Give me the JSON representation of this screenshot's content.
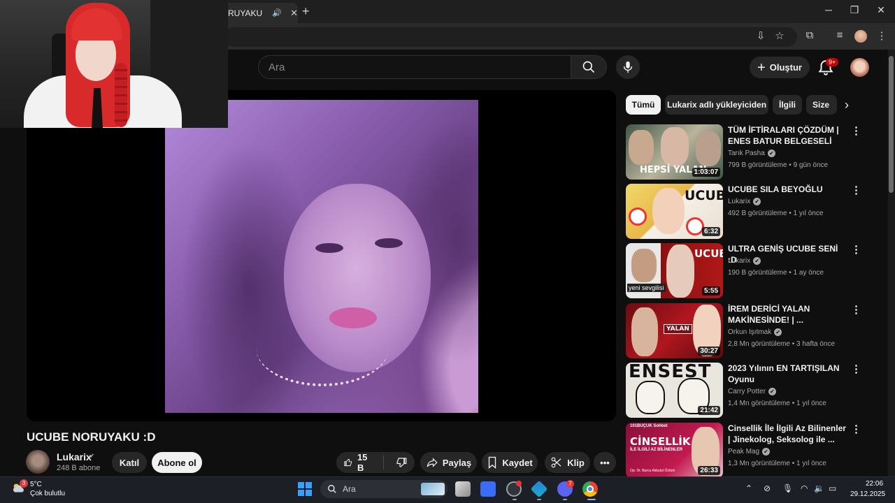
{
  "browser": {
    "tab_title": "RUYAKU :D",
    "tab_audio_icon": "speaker-icon",
    "new_tab_icon": "plus-icon",
    "window_controls": {
      "minimize": "─",
      "restore": "❐",
      "close": "✕"
    }
  },
  "youtube": {
    "search_placeholder": "Ara",
    "create_label": "Oluştur",
    "notification_count": "9+"
  },
  "video": {
    "title": "UCUBE NORUYAKU :D",
    "channel": "Lukarix",
    "subscribers": "248 B abone",
    "join_label": "Katıl",
    "subscribe_label": "Abone ol",
    "likes": "15 B",
    "share_label": "Paylaş",
    "save_label": "Kaydet",
    "clip_label": "Klip"
  },
  "chips": [
    "Tümü",
    "Lukarix adlı yükleyiciden",
    "İlgili",
    "Size"
  ],
  "recommendations": [
    {
      "title": "TÜM İFTİRALARI ÇÖZDÜM | ENES BATUR BELGESELİ",
      "channel": "Tarık Pasha",
      "views": "799 B görüntüleme",
      "age": "9 gün önce",
      "duration": "1:03:07",
      "thumb_text": "HEPSİ YALAN"
    },
    {
      "title": "UCUBE SILA BEYOĞLU",
      "channel": "Lukarix",
      "views": "492 B görüntüleme",
      "age": "1 yıl önce",
      "duration": "6:32",
      "thumb_text": "UCUBE"
    },
    {
      "title": "ULTRA GENİŞ UCUBE SENİ :D",
      "channel": "Lukarix",
      "views": "190 B görüntüleme",
      "age": "1 ay önce",
      "duration": "5:55",
      "thumb_text": "UCUBE",
      "thumb_caption": "yeni sevgilisi"
    },
    {
      "title": "İREM DERİCİ YALAN MAKİNESİNDE! | ...",
      "channel": "Orkun Işıtmak",
      "views": "2,8 Mn görüntüleme",
      "age": "3 hafta önce",
      "duration": "30:27",
      "thumb_text": "YALAN"
    },
    {
      "title": "2023 Yılının EN TARTIŞILAN Oyunu",
      "channel": "Carry Potter",
      "views": "1,4 Mn görüntüleme",
      "age": "1 yıl önce",
      "duration": "21:42",
      "thumb_text": "ENSEST"
    },
    {
      "title": "Cinsellik İle İlgili Az Bilinenler | Jinekolog, Seksolog ile ...",
      "channel": "Peak Mag",
      "views": "1,3 Mn görüntüleme",
      "age": "1 yıl önce",
      "duration": "26:33",
      "thumb_text": "CİNSELLİK",
      "thumb_caption": "İLE İLGİLİ AZ BİLİNENLER",
      "thumb_top": "101BUÇUK Sohbet",
      "thumb_name": "Op. Dr. Burcu Akbulut Öztürk"
    }
  ],
  "taskbar": {
    "weather_badge": "3",
    "temperature": "5°C",
    "condition": "Çok bulutlu",
    "search_label": "Ara",
    "discord_badge": "7",
    "time": "22:06",
    "date": "29.12.2025"
  },
  "colors": {
    "accent": "#cc0000",
    "background": "#0f0f0f",
    "chip_active": "#f1f1f1"
  }
}
